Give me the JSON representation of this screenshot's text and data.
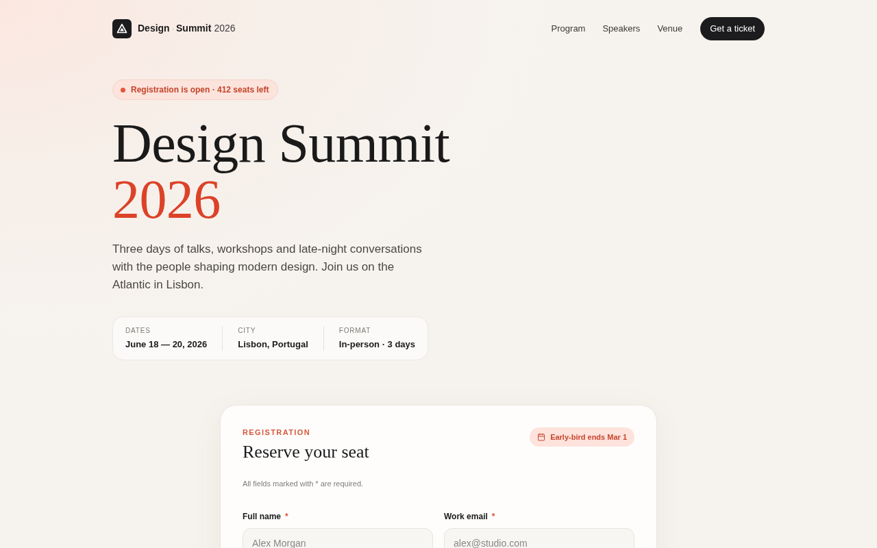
{
  "brand": {
    "parts": [
      {
        "text": "Design",
        "kind": "strong"
      },
      {
        "text": "·",
        "kind": "dot"
      },
      {
        "text": "Summit",
        "kind": "strong"
      },
      {
        "text": "2026",
        "kind": "plain"
      }
    ]
  },
  "nav": {
    "links": [
      "Program",
      "Speakers",
      "Venue"
    ],
    "cta": "Get a ticket"
  },
  "hero": {
    "status_badge": "Registration is open · 412 seats left",
    "title": "Design Summit",
    "title_accent": "2026",
    "description": "Three days of talks, workshops and late-night conversations with the people shaping modern design. Join us on the Atlantic in Lisbon.",
    "facts": [
      {
        "label": "DATES",
        "value": "June 18 — 20, 2026"
      },
      {
        "label": "CITY",
        "value": "Lisbon, Portugal"
      },
      {
        "label": "FORMAT",
        "value": "In-person · 3 days"
      }
    ]
  },
  "registration": {
    "eyebrow": "REGISTRATION",
    "title": "Reserve your seat",
    "badge": "Early-bird ends Mar 1",
    "note": "All fields marked with * are required.",
    "fields": [
      {
        "label": "Full name",
        "required_mark": "*",
        "placeholder": "Alex Morgan"
      },
      {
        "label": "Work email",
        "required_mark": "*",
        "placeholder": "alex@studio.com"
      }
    ]
  }
}
